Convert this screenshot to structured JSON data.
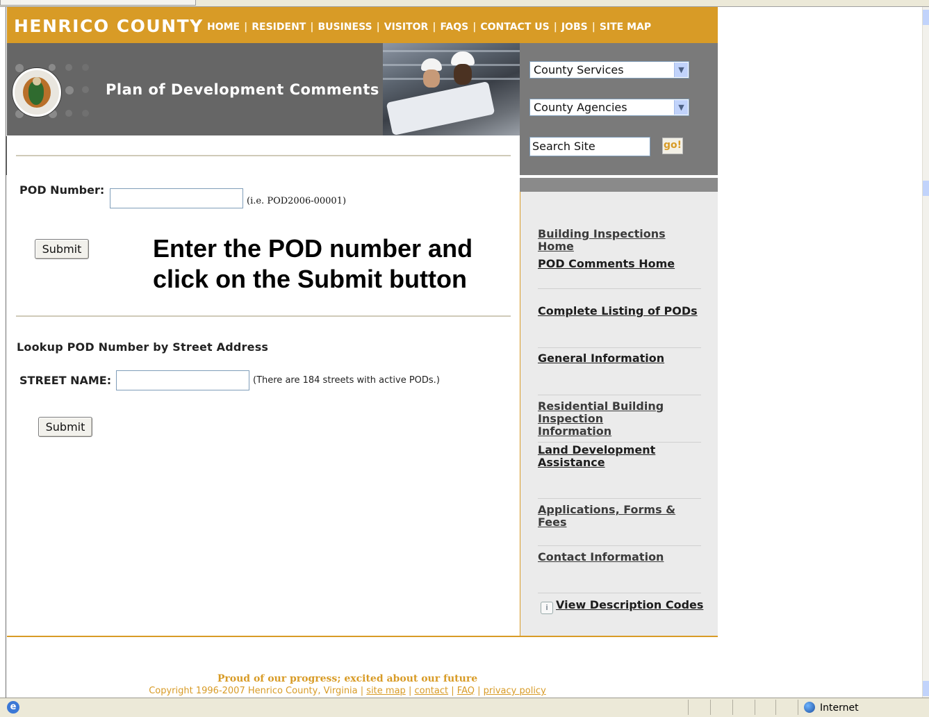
{
  "header": {
    "logo": "HENRICO COUNTY",
    "nav": [
      "HOME",
      "RESIDENT",
      "BUSINESS",
      "VISITOR",
      "FAQS",
      "CONTACT US",
      "JOBS",
      "SITE MAP"
    ]
  },
  "banner": {
    "title": "Plan of Development Comments"
  },
  "top_panel": {
    "select1": "County Services",
    "select2": "County Agencies",
    "search_value": "Search Site",
    "go_label": "go!"
  },
  "form": {
    "pod_label": "POD Number:",
    "pod_value": "",
    "pod_hint": "(i.e. POD2006-00001)",
    "submit_label": "Submit",
    "instruction": "Enter the POD number and click on the Submit button",
    "lookup_title": "Lookup POD Number by Street Address",
    "street_label": "STREET NAME:",
    "street_value": "",
    "street_hint": "(There are 184 streets with active PODs.)",
    "submit2_label": "Submit"
  },
  "sidebar": {
    "links": [
      "Building Inspections Home",
      "POD Comments Home",
      "Complete Listing of PODs",
      "General Information",
      "Residential Building Inspection Information",
      "Land Development Assistance",
      "Applications, Forms & Fees",
      "Contact Information",
      "View Description Codes"
    ],
    "info_icon_glyph": "i"
  },
  "footer": {
    "tagline": "Proud of our progress; excited about our future",
    "copyright": "Copyright 1996-2007 Henrico County, Virginia |",
    "links": [
      "site map",
      "contact",
      "FAQ",
      "privacy policy"
    ],
    "sep": "|"
  },
  "statusbar": {
    "zone": "Internet",
    "ie_glyph": "e"
  },
  "icons": [
    "ie-icon",
    "globe-icon",
    "info-icon",
    "chevron-down-icon"
  ],
  "colors": {
    "accent": "#d89b26",
    "banner": "#666666",
    "panel": "#7a7a7a",
    "sidebar": "#ebebeb"
  }
}
